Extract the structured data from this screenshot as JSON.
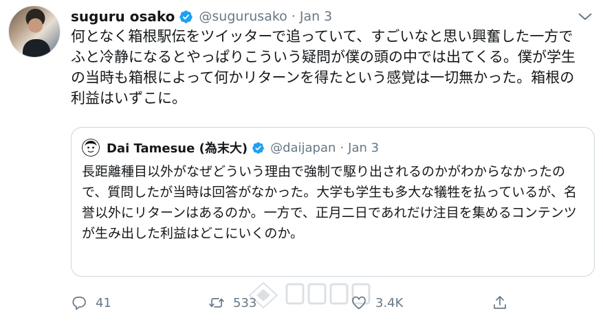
{
  "tweet": {
    "author_name": "suguru osako",
    "author_handle": "@sugurusako",
    "separator": "·",
    "date": "Jan 3",
    "text": "何となく箱根駅伝をツイッターで追っていて、すごいなと思い興奮した一方でふと冷静になるとやっぱりこういう疑問が僕の頭の中では出てくる。僕が学生の当時も箱根によって何かリターンを得たという感覚は一切無かった。箱根の利益はいずこに。",
    "verified_icon": "verified-badge-icon",
    "menu_icon": "chevron-down-icon"
  },
  "quoted": {
    "author_name": "Dai Tamesue (為末大)",
    "author_handle": "@daijapan",
    "separator": "·",
    "date": "Jan 3",
    "text": "長距離種目以外がなぜどういう理由で強制で駆り出されるのかがわからなかったので、質問したが当時は回答がなかった。大学も学生も多大な犠牲を払っているが、名誉以外にリターンはあるのか。一方で、正月二日であれだけ注目を集めるコンテンツが生み出した利益はどこにいくのか。"
  },
  "actions": {
    "replies": "41",
    "retweets": "533",
    "likes": "3.4K"
  },
  "colors": {
    "text": "#14171a",
    "secondary": "#657786",
    "verified": "#1da1f2",
    "border": "#ccd6dd"
  }
}
